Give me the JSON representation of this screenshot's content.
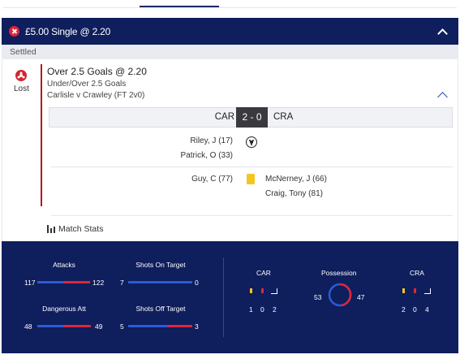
{
  "header": {
    "title": "£5.00 Single @ 2.20"
  },
  "status": "Settled",
  "bet": {
    "result": "Lost",
    "selection": "Over 2.5 Goals @ 2.20",
    "market": "Under/Over 2.5 Goals",
    "event": "Carlisle v Crawley (FT 2v0)"
  },
  "score": {
    "home": "CAR",
    "away": "CRA",
    "score": "2 - 0"
  },
  "events": {
    "goals_home": [
      "Riley, J (17)",
      "Patrick, O (33)"
    ],
    "cards_home": [
      "Guy, C (77)"
    ],
    "cards_away": [
      "McNerney, J (66)",
      "Craig, Tony (81)"
    ]
  },
  "match_stats_label": "Match Stats",
  "stats": {
    "attacks": {
      "label": "Attacks",
      "home": "117",
      "away": "122"
    },
    "shots_on": {
      "label": "Shots On Target",
      "home": "7",
      "away": "0"
    },
    "dangerous": {
      "label": "Dangerous Att",
      "home": "48",
      "away": "49"
    },
    "shots_off": {
      "label": "Shots Off Target",
      "home": "5",
      "away": "3"
    },
    "home_team": "CAR",
    "away_team": "CRA",
    "possession_label": "Possession",
    "possession_home": "53",
    "possession_away": "47",
    "home_counts": [
      "1",
      "0",
      "2"
    ],
    "away_counts": [
      "2",
      "0",
      "4"
    ]
  },
  "colors": {
    "header": "#0f1e5c",
    "accent_red": "#e0253a",
    "accent_blue": "#2c5bd4",
    "yellow": "#f3c624"
  }
}
